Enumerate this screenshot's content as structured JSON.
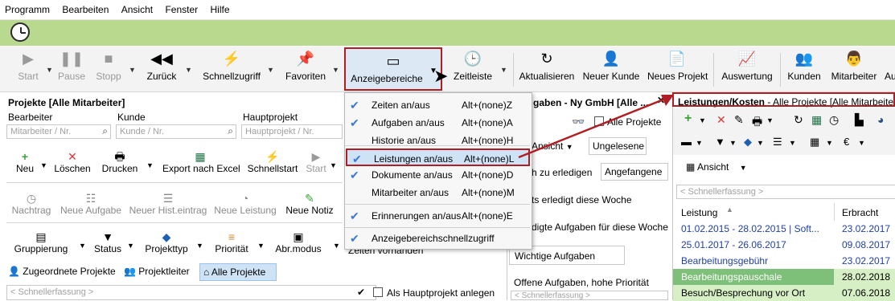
{
  "menu": [
    "Programm",
    "Bearbeiten",
    "Ansicht",
    "Fenster",
    "Hilfe"
  ],
  "toolbar": {
    "start": "Start",
    "pause": "Pause",
    "stopp": "Stopp",
    "zurueck": "Zurück",
    "schnellzugriff": "Schnellzugriff",
    "favoriten": "Favoriten",
    "anzeigebereiche": "Anzeigebereiche",
    "zeitleiste": "Zeitleiste",
    "aktualisieren": "Aktualisieren",
    "neuer_kunde": "Neuer Kunde",
    "neues_projekt": "Neues Projekt",
    "auswertung": "Auswertung",
    "kunden": "Kunden",
    "mitarbeiter": "Mitarbeiter",
    "au": "Au"
  },
  "left": {
    "title": "Projekte [Alle Mitarbeiter]",
    "labels": {
      "bearbeiter": "Bearbeiter",
      "kunde": "Kunde",
      "hauptprojekt": "Hauptprojekt"
    },
    "placeholders": {
      "bearbeiter": "Mitarbeiter / Nr.",
      "kunde": "Kunde / Nr.",
      "hauptprojekt": "Hauptprojekt / Nr."
    },
    "row1": {
      "neu": "Neu",
      "loeschen": "Löschen",
      "drucken": "Drucken",
      "export": "Export nach Excel",
      "schnellstart": "Schnellstart",
      "start": "Start"
    },
    "row2": {
      "nachtrag": "Nachtrag",
      "neue_aufgabe": "Neue Aufgabe",
      "neuer_hist": "Neuer Hist.eintrag",
      "neue_leistung": "Neue Leistung",
      "neue_notiz": "Neue Notiz"
    },
    "row3": {
      "gruppierung": "Gruppierung",
      "status": "Status",
      "projekttyp": "Projekttyp",
      "prioritaet": "Priorität",
      "abrmodus": "Abr.modus"
    },
    "tabs": [
      "Zugeordnete Projekte",
      "Projektleiter",
      "Alle Projekte"
    ],
    "quick": "< Schnellerfassung >",
    "hauptprojekt_anlegen": "Als Hauptprojekt anlegen"
  },
  "mid": {
    "title": "gaben - Ny GmbH [Alle ...",
    "alle_projekte": "Alle Projekte",
    "ansicht": "Ansicht",
    "ungelesene": "Ungelesene",
    "zu_erledigen": "h zu erledigen",
    "angefangene": "Angefangene",
    "erledigt_woche": "ts erledigt diese Woche",
    "aufgaben_woche": "digte Aufgaben für diese Woche",
    "zeiten_vorhanden": "Zeiten vorhanden",
    "wichtige": "Wichtige Aufgaben",
    "offene": "Offene Aufgaben, hohe Priorität",
    "quick": "< Schnellerfassung >"
  },
  "dropdown": [
    {
      "label": "Zeiten an/aus",
      "key": "Alt+(none)Z",
      "checked": true
    },
    {
      "label": "Aufgaben an/aus",
      "key": "Alt+(none)A",
      "checked": true
    },
    {
      "label": "Historie an/aus",
      "key": "Alt+(none)H",
      "checked": false
    },
    {
      "label": "Leistungen an/aus",
      "key": "Alt+(none)L",
      "checked": true
    },
    {
      "label": "Dokumente an/aus",
      "key": "Alt+(none)D",
      "checked": true
    },
    {
      "label": "Mitarbeiter an/aus",
      "key": "Alt+(none)M",
      "checked": false
    },
    {
      "label": "Erinnerungen an/aus",
      "key": "Alt+(none)E",
      "checked": true
    },
    {
      "label": "Anzeigebereichschnellzugriff",
      "key": "",
      "checked": true
    }
  ],
  "right": {
    "title": "Leistungen/Kosten",
    "subtitle": " - Alle Projekte [Alle Mitarbeiter]",
    "ansicht": "Ansicht",
    "quick": "< Schnellerfassung >",
    "col1": "Leistung",
    "col2": "Erbracht",
    "rows": [
      {
        "l": "01.02.2015 - 28.02.2015 | Soft...",
        "d": "23.02.2017",
        "color": "#1f3fa8",
        "bg": "#ffffff"
      },
      {
        "l": "25.01.2017 - 26.06.2017",
        "d": "09.08.2017",
        "color": "#1f3fa8",
        "bg": "#ffffff"
      },
      {
        "l": "Bearbeitungsgebühr",
        "d": "23.02.2017",
        "color": "#1f3fa8",
        "bg": "#ffffff"
      },
      {
        "l": "Bearbeitungspauschale",
        "d": "28.02.2018",
        "color": "#ffffff",
        "bg": "#7ec07a"
      },
      {
        "l": "Besuch/Besprechung vor Ort",
        "d": "07.06.2018",
        "color": "#000000",
        "bg": "#d7efc4"
      }
    ]
  }
}
